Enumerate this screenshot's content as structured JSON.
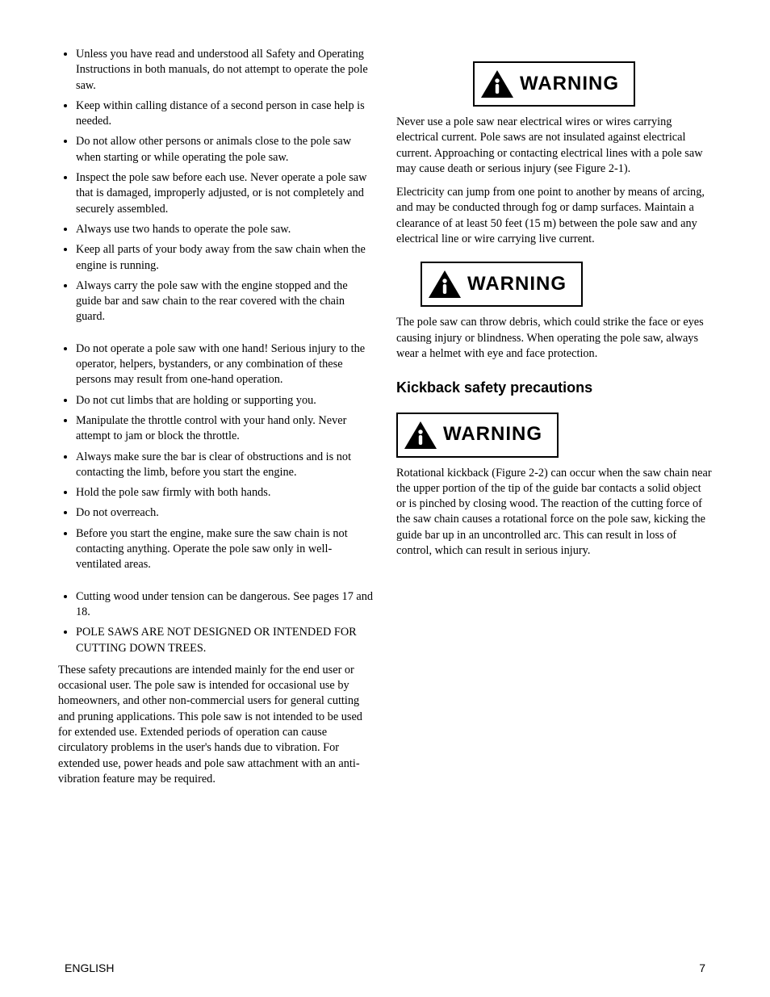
{
  "left_column": {
    "bullets_group1": [
      "Unless you have read and understood all Safety and Operating Instructions in both manuals, do not attempt to operate the pole saw.",
      "Keep within calling distance of a second person in case help is needed.",
      "Do not allow other persons or animals close to the pole saw when starting or while operating the pole saw.",
      "Inspect the pole saw before each use. Never operate a pole saw that is damaged, improperly adjusted, or is not completely and securely assembled.",
      "Always use two hands to operate the pole saw.",
      "Keep all parts of your body away from the saw chain when the engine is running.",
      "Always carry the pole saw with the engine stopped and the guide bar and saw chain to the rear covered with the chain guard."
    ],
    "bullets_group2": [
      "Do not operate a pole saw with one hand! Serious injury to the operator, helpers, bystanders, or any combination of these persons may result from one-hand operation.",
      "Do not cut limbs that are holding or supporting you.",
      "Manipulate the throttle control with your hand only. Never attempt to jam or block the throttle.",
      "Always make sure the bar is clear of obstructions and is not contacting the limb, before you start the engine.",
      "Hold the pole saw firmly with both hands.",
      "Do not overreach.",
      "Before you start the engine, make sure the saw chain is not contacting anything. Operate the pole saw only in well-ventilated areas."
    ],
    "bullets_group3": [
      "Cutting wood under tension can be dangerous. See pages 17 and 18.",
      "POLE SAWS ARE NOT DESIGNED OR INTENDED FOR CUTTING DOWN TREES."
    ],
    "paragraph": "These safety precautions are intended mainly for the end user or occasional user. The pole saw is intended for occasional use by homeowners, and other non-commercial users for general cutting and pruning applications. This pole saw is not intended to be used for extended use. Extended periods of operation can cause circulatory problems in the user's hands due to vibration. For extended use, power heads and pole saw attachment with an anti-vibration feature may be required."
  },
  "right_column": {
    "warning1": {
      "label": "WARNING",
      "body": [
        "Never use a pole saw near electrical wires or wires carrying electrical current. Pole saws are not insulated against electrical current. Approaching or contacting electrical lines with a pole saw may cause death or serious injury (see Figure 2-1).",
        "Electricity can jump from one point to another by means of arcing, and may be conducted through fog or damp surfaces. Maintain a clearance of at least 50 feet (15 m) between the pole saw and any electrical line or wire carrying live current."
      ]
    },
    "warning2": {
      "label": "WARNING",
      "body": [
        "The pole saw can throw debris, which could strike the face or eyes causing injury or blindness. When operating the pole saw, always wear a helmet with eye and face protection."
      ]
    },
    "section_heading": "Kickback safety precautions",
    "warning3": {
      "label": "WARNING",
      "body": [
        "Rotational kickback (Figure 2-2) can occur when the saw chain near the upper portion of the tip of the guide bar contacts a solid object or is pinched by closing wood. The reaction of the cutting force of the saw chain causes a rotational force on the pole saw, kicking the guide bar up in an uncontrolled arc. This can result in loss of control, which can result in serious injury."
      ]
    }
  },
  "footer": {
    "left": "ENGLISH",
    "right": "7"
  }
}
